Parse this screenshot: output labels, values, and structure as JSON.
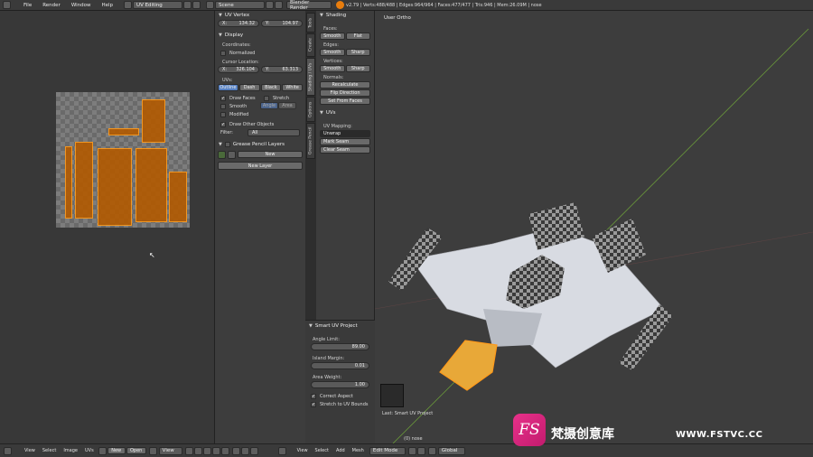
{
  "topbar": {
    "menus": [
      "File",
      "Render",
      "Window",
      "Help"
    ],
    "screen_layout": "UV Editing",
    "scene": "Scene",
    "render_engine": "Blender Render",
    "stats": "v2.79 | Verts:488/488 | Edges:964/964 | Faces:477/477 | Tris:946 | Mem:26.09M | nose"
  },
  "uv_vertex": {
    "header": "UV Vertex",
    "x_label": "X:",
    "x_value": "134.32",
    "y_label": "Y:",
    "y_value": "104.97"
  },
  "display": {
    "header": "Display",
    "coordinates_label": "Coordinates:",
    "normalized_label": "Normalized",
    "cursor_label": "Cursor Location:",
    "cx_label": "X:",
    "cx_value": "326.104",
    "cy_label": "Y:",
    "cy_value": "63.313",
    "uvs_label": "UVs:",
    "uv_modes": [
      "Outline",
      "Dash",
      "Black",
      "White"
    ],
    "draw_faces": "Draw Faces",
    "stretch": "Stretch",
    "smooth": "Smooth",
    "angle": "Angle",
    "area": "Area",
    "modified": "Modified",
    "draw_other": "Draw Other Objects",
    "filter_label": "Filter:",
    "filter_value": "All"
  },
  "grease_pencil": {
    "header": "Grease Pencil Layers",
    "new_label": "New",
    "new_layer_label": "New Layer"
  },
  "vtabs": [
    "Tools",
    "Create",
    "Shading / UVs",
    "Options",
    "Grease Pencil"
  ],
  "shading": {
    "header": "Shading",
    "faces_label": "Faces:",
    "smooth": "Smooth",
    "flat": "Flat",
    "edges_label": "Edges:",
    "edges_smooth": "Smooth",
    "edges_sharp": "Sharp",
    "vertices_label": "Vertices:",
    "verts_smooth": "Smooth",
    "verts_sharp": "Sharp",
    "normals_label": "Normals:",
    "recalculate": "Recalculate",
    "flip_direction": "Flip Direction",
    "set_from_faces": "Set From Faces"
  },
  "uvs_panel": {
    "header": "UVs",
    "mapping_label": "UV Mapping:",
    "unwrap": "Unwrap",
    "mark_seam": "Mark Seam",
    "clear_seam": "Clear Seam"
  },
  "operator": {
    "header": "Smart UV Project",
    "angle_limit_label": "Angle Limit:",
    "angle_limit_value": "89.00",
    "island_margin_label": "Island Margin:",
    "island_margin_value": "0.01",
    "area_weight_label": "Area Weight:",
    "area_weight_value": "1.00",
    "correct_aspect": "Correct Aspect",
    "stretch_bounds": "Stretch to UV Bounds"
  },
  "viewport": {
    "view_name": "User Ortho",
    "last_op": "Last: Smart UV Project",
    "object_name": "(0) nose"
  },
  "bottombar": {
    "uv_items": [
      "View",
      "Select",
      "Image",
      "UVs"
    ],
    "new_label": "New",
    "open_label": "Open",
    "view_dd": "View",
    "vp_items": [
      "View",
      "Select",
      "Add",
      "Mesh"
    ],
    "mode": "Edit Mode",
    "orientation": "Global"
  },
  "watermark": {
    "logo": "FS",
    "cn": "梵摄创意库",
    "url": "WWW.FSTVC.CC"
  },
  "colors": {
    "accent_orange": "#ff9a1a",
    "selected_blue": "#5680c2",
    "watermark_pink": "#e8318a"
  }
}
